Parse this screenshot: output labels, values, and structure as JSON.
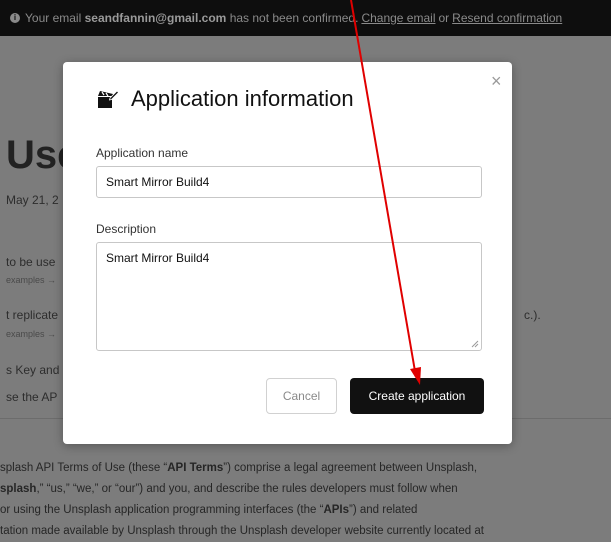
{
  "banner": {
    "prefix": "Your email",
    "email": "seandfannin@gmail.com",
    "middle": "has not been confirmed.",
    "change_link": "Change email",
    "or": "or",
    "resend_link": "Resend confirmation"
  },
  "background": {
    "heading": "Use",
    "date": "May 21, 2",
    "line1": "to be use",
    "examples1": "examples →",
    "line2": "t replicate",
    "line2_right": "c.).",
    "examples2": "examples →",
    "line3": "s Key and",
    "line4": "se the AP",
    "para": [
      {
        "pre": "splash API Terms of Use (these “",
        "bold": "API Terms",
        "post": "”) comprise a legal agreement between Unsplash,"
      },
      {
        "pre": "",
        "bold": "splash",
        "post": ",” “us,” “we,” or “our”) and you, and describe the rules developers must follow when"
      },
      {
        "pre": " or using the Unsplash application programming interfaces (the “",
        "bold": "APIs",
        "post": "”) and related"
      },
      {
        "pre": "",
        "bold": "",
        "post": "tation made available by Unsplash through the Unsplash developer website currently located at"
      }
    ]
  },
  "modal": {
    "title": "Application information",
    "close_glyph": "×",
    "name_label": "Application name",
    "name_value": "Smart Mirror Build4",
    "description_label": "Description",
    "description_value": "Smart Mirror Build4",
    "cancel_label": "Cancel",
    "create_label": "Create application"
  },
  "icons": {
    "title_icon": "edit-clapper-icon",
    "info_icon": "info-circle-icon",
    "close_icon": "close-icon"
  },
  "colors": {
    "overlay": "#7c7c7c",
    "banner_bg": "#0e0e0e",
    "primary_button": "#111111",
    "annotation_arrow": "#e00000"
  }
}
